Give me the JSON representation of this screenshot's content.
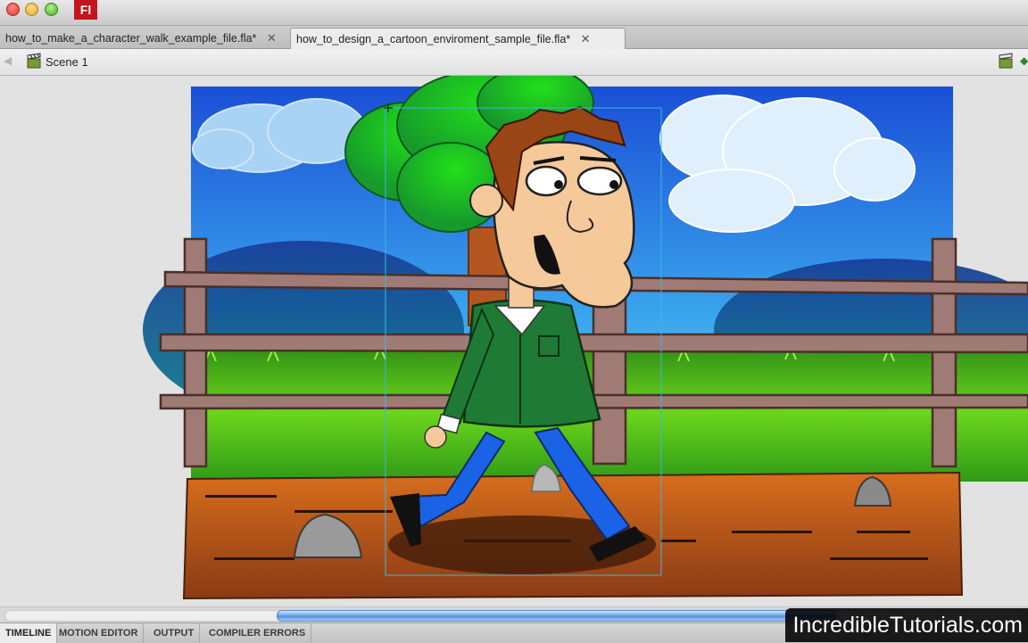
{
  "app": {
    "logo_text": "Fl"
  },
  "tabs": [
    {
      "label": "how_to_make_a_character_walk_example_file.fla*",
      "close": "✕",
      "active": false
    },
    {
      "label": "how_to_design_a_cartoon_enviroment_sample_file.fla*",
      "close": "✕",
      "active": true
    }
  ],
  "editbar": {
    "scene_label": "Scene 1"
  },
  "panels": [
    "TIMELINE",
    "MOTION EDITOR",
    "OUTPUT",
    "COMPILER ERRORS"
  ],
  "watermark": "IncredibleTutorials.com",
  "colors": {
    "sky_top": "#1a4fd6",
    "sky_bottom": "#8fd2f7",
    "grass": "#3fae1c",
    "dirt": "#c8651b",
    "fence": "#a07a74",
    "jacket": "#1f7a35",
    "pants": "#1a63e6",
    "skin": "#f5c99a",
    "hair": "#9a4515",
    "selection": "#3fb6e0"
  }
}
